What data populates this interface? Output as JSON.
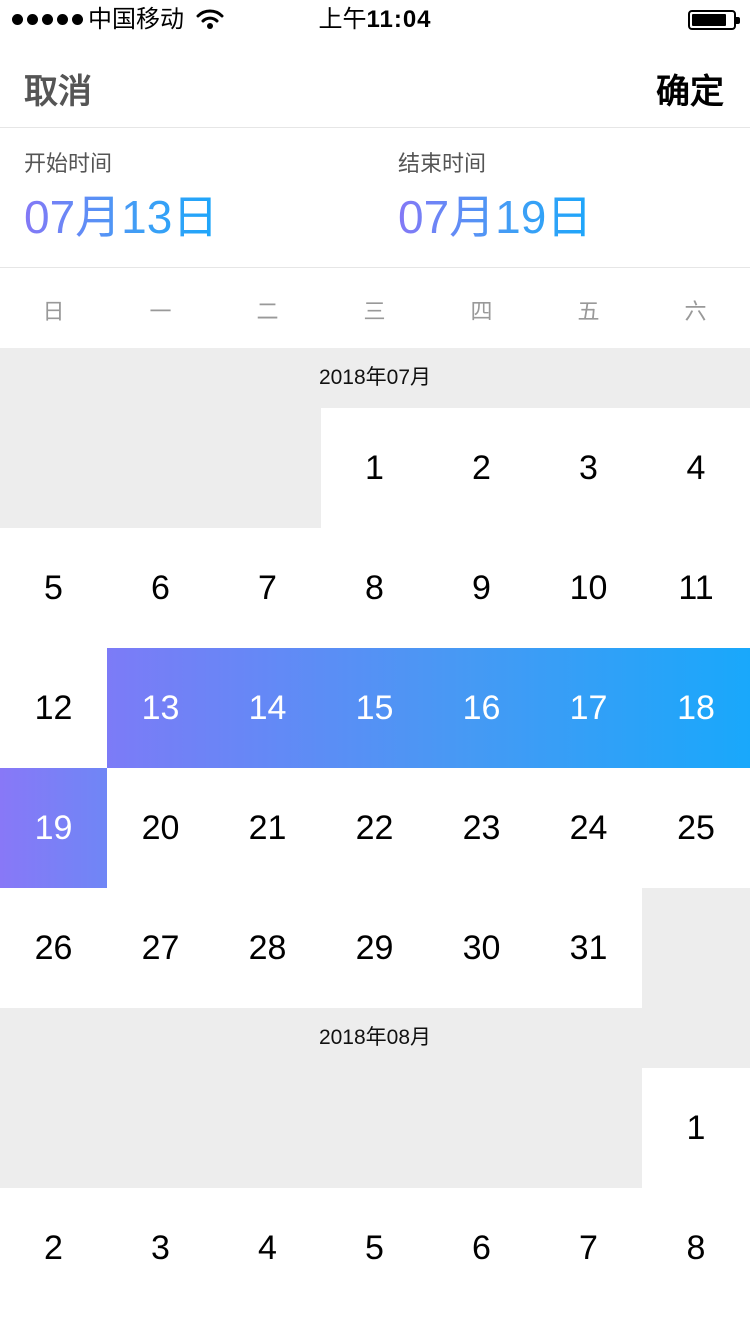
{
  "status_bar": {
    "carrier": "中国移动",
    "time_prefix": "上午",
    "time": "11:04"
  },
  "nav": {
    "cancel_label": "取消",
    "confirm_label": "确定"
  },
  "range": {
    "start_label": "开始时间",
    "start_value": "07月13日",
    "end_label": "结束时间",
    "end_value": "07月19日"
  },
  "weekdays": [
    "日",
    "一",
    "二",
    "三",
    "四",
    "五",
    "六"
  ],
  "months": [
    {
      "title": "2018年07月",
      "rows": [
        [
          "",
          "",
          "",
          "1",
          "2",
          "3",
          "4"
        ],
        [
          "5",
          "6",
          "7",
          "8",
          "9",
          "10",
          "11"
        ],
        [
          "12",
          "13",
          "14",
          "15",
          "16",
          "17",
          "18"
        ],
        [
          "19",
          "20",
          "21",
          "22",
          "23",
          "24",
          "25"
        ],
        [
          "26",
          "27",
          "28",
          "29",
          "30",
          "31",
          ""
        ]
      ]
    },
    {
      "title": "2018年08月",
      "rows": [
        [
          "",
          "",
          "",
          "",
          "",
          "",
          "1"
        ],
        [
          "2",
          "3",
          "4",
          "5",
          "6",
          "7",
          "8"
        ]
      ]
    }
  ],
  "colors": {
    "gradient_start": "#8478f6",
    "gradient_end": "#1ba6fb",
    "empty_bg": "#ededed"
  }
}
